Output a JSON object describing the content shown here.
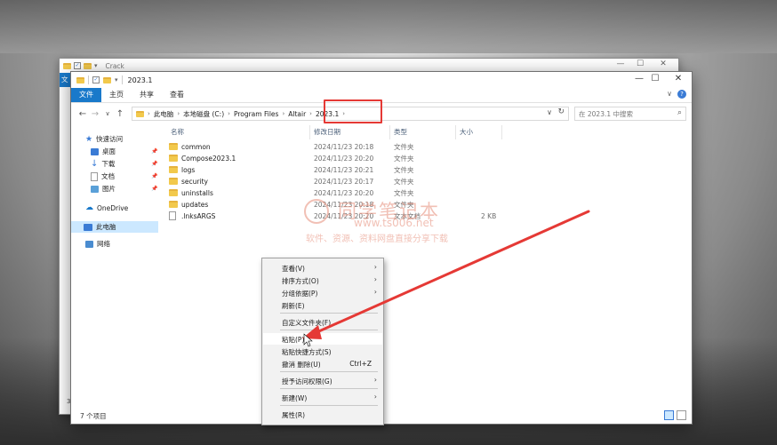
{
  "back_window": {
    "title": "Crack",
    "tab_letter": "文",
    "side_number": "3"
  },
  "window": {
    "title": "2023.1",
    "controls": {
      "minimize": "—",
      "maximize": "☐",
      "close": "✕"
    }
  },
  "ribbon": {
    "tabs": [
      "文件",
      "主页",
      "共享",
      "查看"
    ],
    "expand": "∨",
    "help": "?"
  },
  "nav": {
    "back": "←",
    "forward": "→",
    "recent": "∨",
    "up": "↑",
    "breadcrumb": [
      "此电脑",
      "本地磁盘 (C:)",
      "Program Files",
      "Altair",
      "2023.1"
    ],
    "search_placeholder": "在 2023.1 中搜索"
  },
  "sidebar": {
    "quick_access": "快速访问",
    "items": [
      {
        "label": "桌面"
      },
      {
        "label": "下载"
      },
      {
        "label": "文档"
      },
      {
        "label": "图片"
      }
    ],
    "onedrive": "OneDrive",
    "this_pc": "此电脑",
    "network": "网络"
  },
  "columns": {
    "name": "名称",
    "date": "修改日期",
    "type": "类型",
    "size": "大小"
  },
  "files": [
    {
      "name": "common",
      "date": "2024/11/23 20:18",
      "type": "文件夹",
      "size": "",
      "kind": "folder"
    },
    {
      "name": "Compose2023.1",
      "date": "2024/11/23 20:20",
      "type": "文件夹",
      "size": "",
      "kind": "folder"
    },
    {
      "name": "logs",
      "date": "2024/11/23 20:21",
      "type": "文件夹",
      "size": "",
      "kind": "folder"
    },
    {
      "name": "security",
      "date": "2024/11/23 20:17",
      "type": "文件夹",
      "size": "",
      "kind": "folder"
    },
    {
      "name": "uninstalls",
      "date": "2024/11/23 20:20",
      "type": "文件夹",
      "size": "",
      "kind": "folder"
    },
    {
      "name": "updates",
      "date": "2024/11/23 20:18",
      "type": "文件夹",
      "size": "",
      "kind": "folder"
    },
    {
      "name": ".lnksARGS",
      "date": "2024/11/23 20:20",
      "type": "文本文档",
      "size": "2 KB",
      "kind": "file"
    }
  ],
  "status": {
    "count": "7 个项目"
  },
  "watermark": {
    "line1": "同学笔记本",
    "line2": "www.ts006.net",
    "line3": "软件、资源、资料网盘直接分享下载"
  },
  "context_menu": {
    "items": [
      {
        "label": "查看(V)",
        "submenu": true,
        "shortcut": ""
      },
      {
        "label": "排序方式(O)",
        "submenu": true,
        "shortcut": ""
      },
      {
        "label": "分组依据(P)",
        "submenu": true,
        "shortcut": ""
      },
      {
        "label": "刷新(E)",
        "submenu": false,
        "shortcut": ""
      },
      {
        "label": "自定义文件夹(F)...",
        "submenu": false,
        "shortcut": ""
      },
      {
        "label": "粘贴(P)",
        "submenu": false,
        "shortcut": "",
        "highlighted": true
      },
      {
        "label": "粘贴快捷方式(S)",
        "submenu": false,
        "shortcut": ""
      },
      {
        "label": "撤消 删除(U)",
        "submenu": false,
        "shortcut": "Ctrl+Z"
      },
      {
        "label": "授予访问权限(G)",
        "submenu": true,
        "shortcut": ""
      },
      {
        "label": "新建(W)",
        "submenu": true,
        "shortcut": ""
      },
      {
        "label": "属性(R)",
        "submenu": false,
        "shortcut": ""
      }
    ]
  },
  "colors": {
    "accent": "#1979ca",
    "folder": "#f2c94c",
    "highlight_box": "#e53935",
    "arrow": "#e53935",
    "selection": "#cce8ff"
  }
}
